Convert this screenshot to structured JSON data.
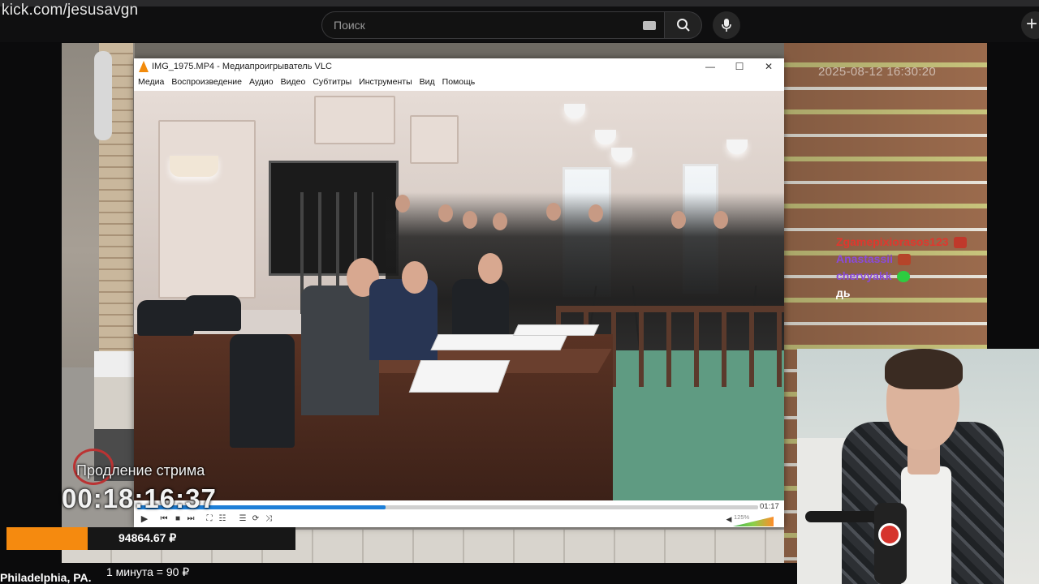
{
  "browser": {
    "url_overlay": "kick.com/jesusavgn",
    "search_placeholder": "Поиск"
  },
  "stream": {
    "timestamp": "2025-08-12 16:30:20",
    "chat": [
      {
        "user": "Zgamepixiorasos123",
        "color": "#e0372e"
      },
      {
        "user": "Anastassii",
        "color": "#8a4bd8"
      },
      {
        "user": "chervyakk",
        "color": "#8a4bd8"
      },
      {
        "user": "дь",
        "color": "#ffffff"
      }
    ],
    "duration_label": "Продление стрима",
    "duration_time": "00:18:16:37",
    "donation_amount": "94864.67 ₽",
    "donation_progress": 0.28,
    "rate_text": "1 минута = 90 ₽",
    "location_text": "Philadelphia, PA."
  },
  "vlc": {
    "title": "IMG_1975.MP4 - Медиапроигрыватель VLC",
    "menu": [
      "Медиа",
      "Воспроизведение",
      "Аудио",
      "Видео",
      "Субтитры",
      "Инструменты",
      "Вид",
      "Помощь"
    ],
    "current_time": "01:17",
    "progress": 0.4,
    "volume_label": "125%",
    "volume_level": 1.25
  },
  "colors": {
    "accent_orange": "#f58a0f",
    "progress_blue": "#1e7fd8"
  },
  "icons": {
    "search": "search-icon",
    "mic": "microphone-icon",
    "keyboard": "keyboard-icon",
    "create": "plus-icon",
    "vlc": "vlc-cone-icon"
  }
}
